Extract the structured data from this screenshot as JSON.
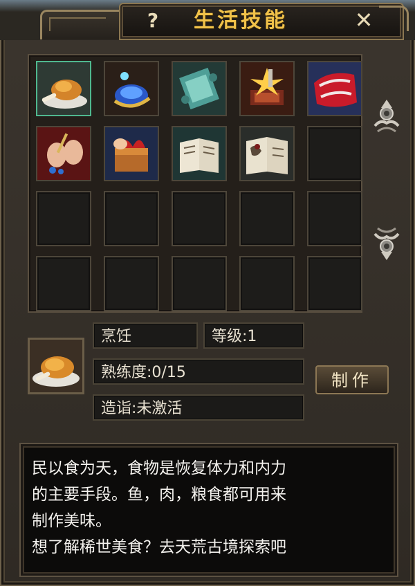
{
  "window": {
    "title": "生活技能",
    "help_icon": "?",
    "close_icon": "✕"
  },
  "grid": {
    "rows": 4,
    "cols": 5,
    "items": [
      {
        "icon": "roast-chicken-icon",
        "selected": true
      },
      {
        "icon": "blue-pouch-icon"
      },
      {
        "icon": "scroll-icon"
      },
      {
        "icon": "anvil-hammer-icon"
      },
      {
        "icon": "red-cloth-icon"
      },
      {
        "icon": "sewing-hands-icon"
      },
      {
        "icon": "gift-box-icon"
      },
      {
        "icon": "book-pages-icon"
      },
      {
        "icon": "painted-book-icon"
      },
      {
        "icon": ""
      },
      {
        "icon": ""
      },
      {
        "icon": ""
      },
      {
        "icon": ""
      },
      {
        "icon": ""
      },
      {
        "icon": ""
      },
      {
        "icon": ""
      },
      {
        "icon": ""
      },
      {
        "icon": ""
      },
      {
        "icon": ""
      },
      {
        "icon": ""
      }
    ]
  },
  "skill": {
    "name": "烹饪",
    "level_text": "等级:1",
    "proficiency_text": "熟练度:0/15",
    "mastery_text": "造诣:未激活",
    "make_button": "制作"
  },
  "description": {
    "text": "民以食为天，食物是恢复体力和内力\n的主要手段。鱼，肉，粮食都可用来\n制作美味。\n想了解稀世美食？去天荒古境探索吧"
  },
  "colors": {
    "title_gold": "#f1c24a",
    "selected_border": "#4fb88f"
  }
}
